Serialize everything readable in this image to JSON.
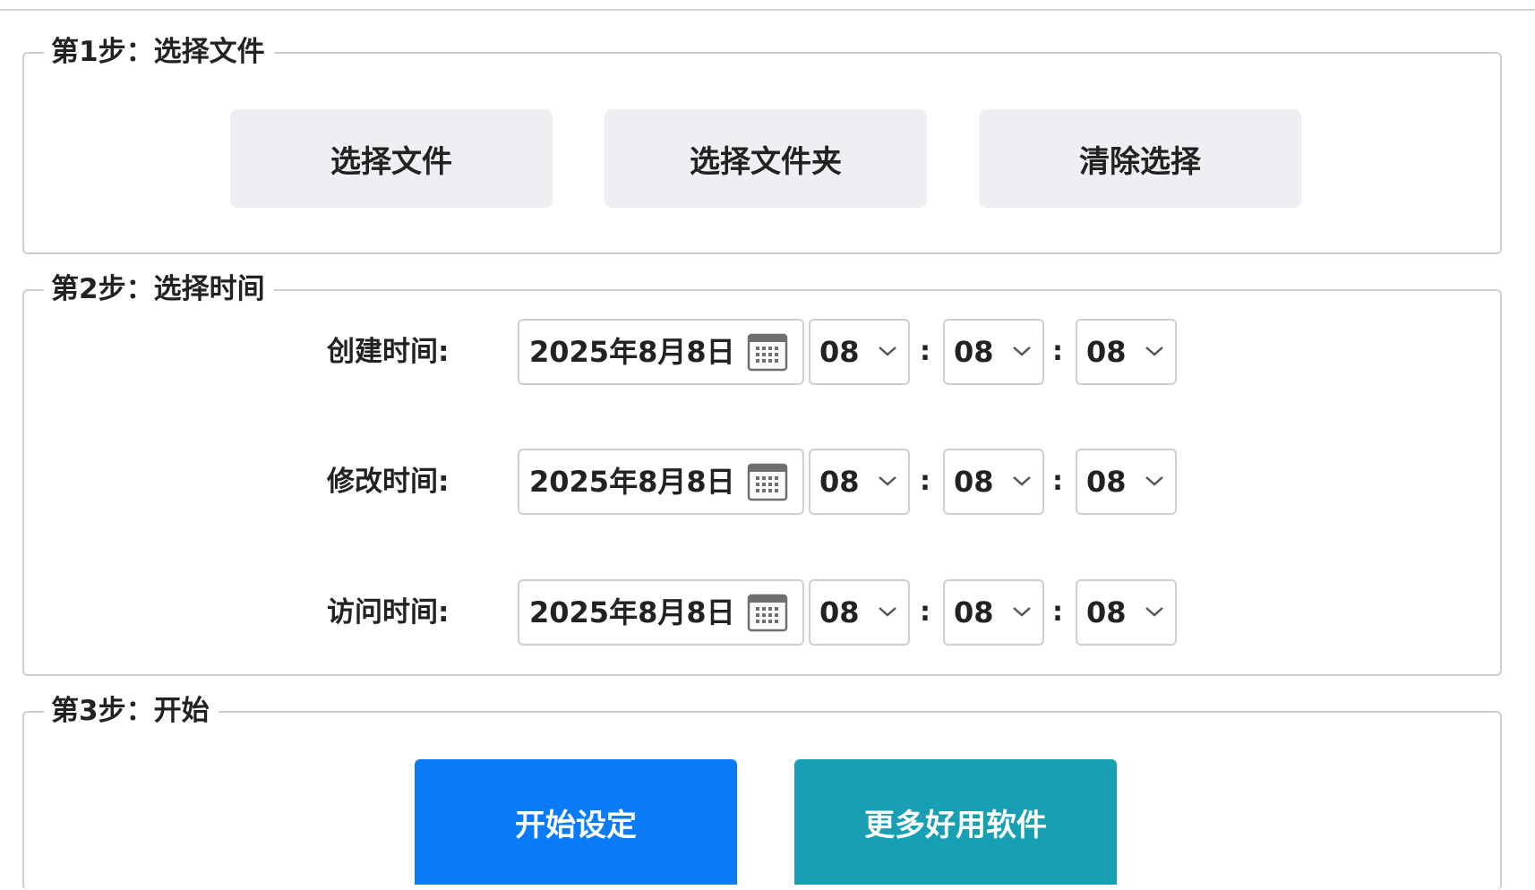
{
  "step1": {
    "legend": "第1步：选择文件",
    "buttons": {
      "select_file": "选择文件",
      "select_folder": "选择文件夹",
      "clear_selection": "清除选择"
    }
  },
  "step2": {
    "legend": "第2步：选择时间",
    "rows": [
      {
        "label": "创建时间:",
        "date": "2025年8月8日",
        "hour": "08",
        "minute": "08",
        "second": "08"
      },
      {
        "label": "修改时间:",
        "date": "2025年8月8日",
        "hour": "08",
        "minute": "08",
        "second": "08"
      },
      {
        "label": "访问时间:",
        "date": "2025年8月8日",
        "hour": "08",
        "minute": "08",
        "second": "08"
      }
    ],
    "separator": ":"
  },
  "step3": {
    "legend": "第3步：开始",
    "buttons": {
      "start": "开始设定",
      "more_software": "更多好用软件"
    }
  },
  "colors": {
    "start_button": "#0a7bf7",
    "more_button": "#189fb3",
    "gray_button": "#edeff2",
    "border": "#cfcfcf"
  },
  "icons": {
    "calendar": "calendar-icon",
    "dropdown": "chevron-down-icon"
  }
}
